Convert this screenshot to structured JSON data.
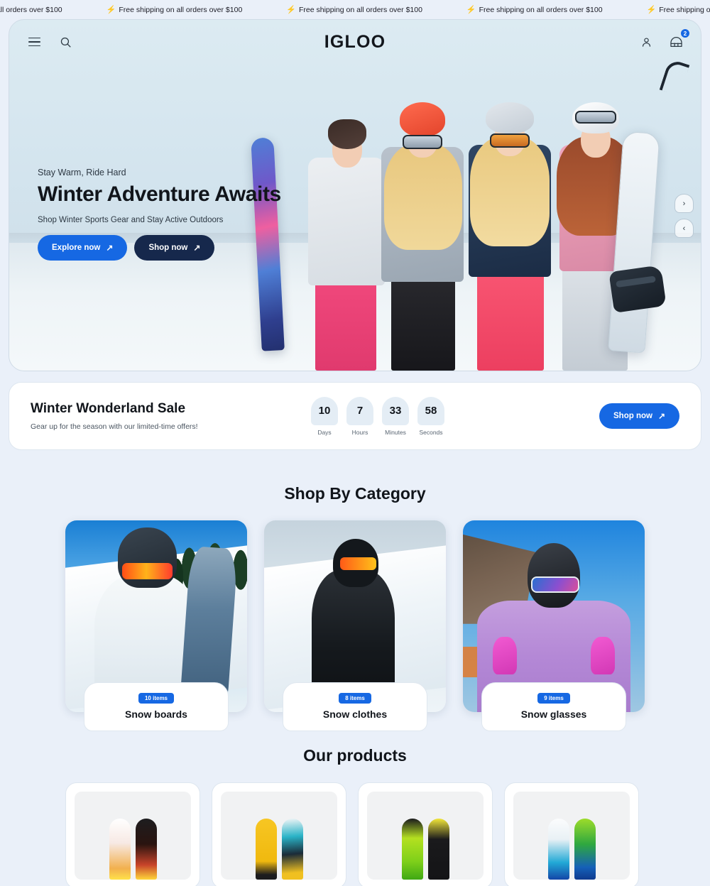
{
  "announcement": {
    "icon": "bolt-icon",
    "message": "Free shipping on all orders over $100",
    "repeat_count": 6
  },
  "header": {
    "brand": "IGLOO",
    "menu_icon": "hamburger-menu-icon",
    "search_icon": "search-icon",
    "account_icon": "user-account-icon",
    "cart_icon": "shopping-cart-icon",
    "cart_count": "2"
  },
  "hero": {
    "eyebrow": "Stay Warm, Ride Hard",
    "title": "Winter Adventure Awaits",
    "subtitle": "Shop Winter Sports Gear and Stay Active Outdoors",
    "primary_button": "Explore now",
    "secondary_button": "Shop now",
    "arrow": "↗",
    "next_arrow": "›",
    "prev_arrow": "‹"
  },
  "sale": {
    "title": "Winter Wonderland Sale",
    "subtitle": "Gear up for the season with our limited-time offers!",
    "cta": "Shop now",
    "arrow": "↗",
    "countdown": [
      {
        "value": "10",
        "label": "Days"
      },
      {
        "value": "7",
        "label": "Hours"
      },
      {
        "value": "33",
        "label": "Minutes"
      },
      {
        "value": "58",
        "label": "Seconds"
      }
    ]
  },
  "categories": {
    "heading": "Shop By Category",
    "items": [
      {
        "name": "Snow boards",
        "items_label": "10 items"
      },
      {
        "name": "Snow clothes",
        "items_label": "8 items"
      },
      {
        "name": "Snow glasses",
        "items_label": "9 items"
      }
    ]
  },
  "products": {
    "heading": "Our products",
    "items": [
      {
        "name": "snowboard-pair-red-white"
      },
      {
        "name": "snowboard-pair-yellow-teal"
      },
      {
        "name": "snowboard-pair-green-black"
      },
      {
        "name": "snowboard-pair-blue-green"
      }
    ]
  },
  "colors": {
    "accent_blue": "#1668e3",
    "dark_navy": "#16284c",
    "page_background": "#eaf0f9",
    "bolt_yellow": "#f7b733"
  }
}
